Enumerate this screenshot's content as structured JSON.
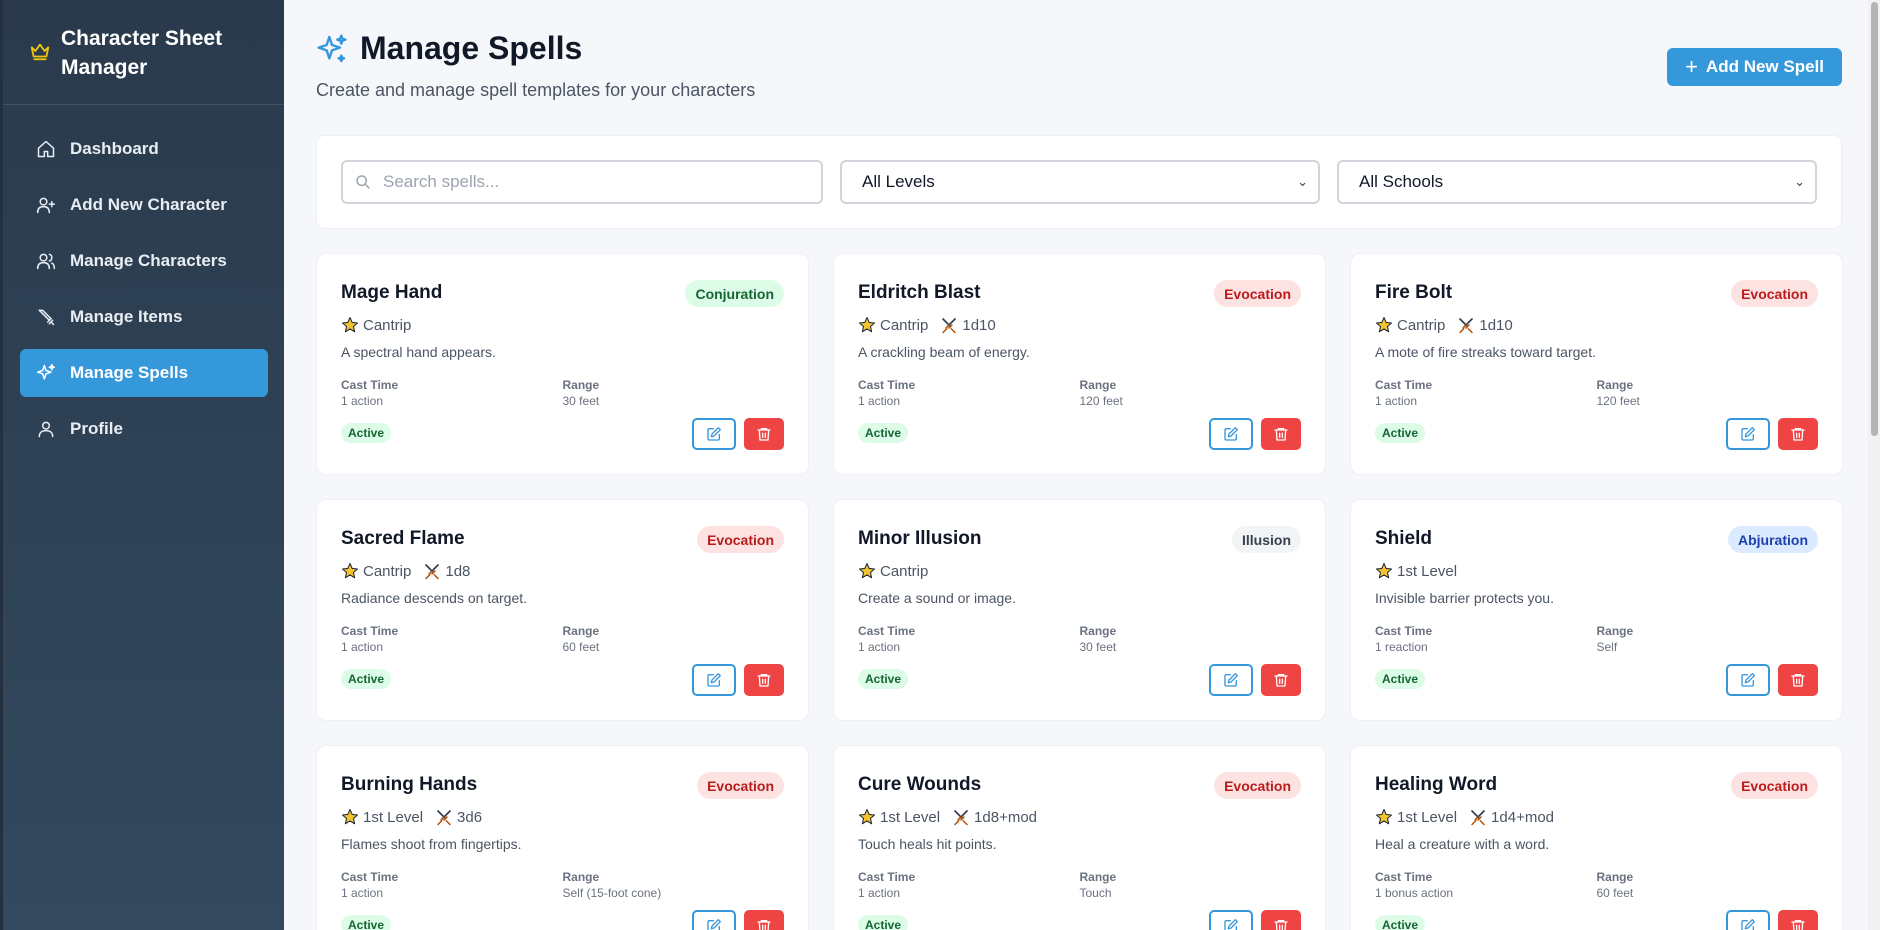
{
  "app": {
    "title": "Character Sheet Manager"
  },
  "sidebar": {
    "items": [
      {
        "label": "Dashboard",
        "icon": "home-icon",
        "active": false
      },
      {
        "label": "Add New Character",
        "icon": "user-plus-icon",
        "active": false
      },
      {
        "label": "Manage Characters",
        "icon": "users-icon",
        "active": false
      },
      {
        "label": "Manage Items",
        "icon": "sword-icon",
        "active": false
      },
      {
        "label": "Manage Spells",
        "icon": "sparkles-icon",
        "active": true
      },
      {
        "label": "Profile",
        "icon": "user-icon",
        "active": false
      }
    ]
  },
  "header": {
    "title": "Manage Spells",
    "subtitle": "Create and manage spell templates for your characters",
    "add_button": "Add New Spell"
  },
  "filters": {
    "search_placeholder": "Search spells...",
    "level_selected": "All Levels",
    "school_selected": "All Schools"
  },
  "labels": {
    "cast_time": "Cast Time",
    "range": "Range"
  },
  "colors": {
    "accent": "#3498db",
    "danger": "#ef4444",
    "sidebar": "#2c3e50"
  },
  "spells": [
    {
      "name": "Mage Hand",
      "school": "Conjuration",
      "level": "Cantrip",
      "damage": "",
      "description": "A spectral hand appears.",
      "cast_time": "1 action",
      "range": "30 feet",
      "status": "Active"
    },
    {
      "name": "Eldritch Blast",
      "school": "Evocation",
      "level": "Cantrip",
      "damage": "1d10",
      "description": "A crackling beam of energy.",
      "cast_time": "1 action",
      "range": "120 feet",
      "status": "Active"
    },
    {
      "name": "Fire Bolt",
      "school": "Evocation",
      "level": "Cantrip",
      "damage": "1d10",
      "description": "A mote of fire streaks toward target.",
      "cast_time": "1 action",
      "range": "120 feet",
      "status": "Active"
    },
    {
      "name": "Sacred Flame",
      "school": "Evocation",
      "level": "Cantrip",
      "damage": "1d8",
      "description": "Radiance descends on target.",
      "cast_time": "1 action",
      "range": "60 feet",
      "status": "Active"
    },
    {
      "name": "Minor Illusion",
      "school": "Illusion",
      "level": "Cantrip",
      "damage": "",
      "description": "Create a sound or image.",
      "cast_time": "1 action",
      "range": "30 feet",
      "status": "Active"
    },
    {
      "name": "Shield",
      "school": "Abjuration",
      "level": "1st Level",
      "damage": "",
      "description": "Invisible barrier protects you.",
      "cast_time": "1 reaction",
      "range": "Self",
      "status": "Active"
    },
    {
      "name": "Burning Hands",
      "school": "Evocation",
      "level": "1st Level",
      "damage": "3d6",
      "description": "Flames shoot from fingertips.",
      "cast_time": "1 action",
      "range": "Self (15-foot cone)",
      "status": "Active"
    },
    {
      "name": "Cure Wounds",
      "school": "Evocation",
      "level": "1st Level",
      "damage": "1d8+mod",
      "description": "Touch heals hit points.",
      "cast_time": "1 action",
      "range": "Touch",
      "status": "Active"
    },
    {
      "name": "Healing Word",
      "school": "Evocation",
      "level": "1st Level",
      "damage": "1d4+mod",
      "description": "Heal a creature with a word.",
      "cast_time": "1 bonus action",
      "range": "60 feet",
      "status": "Active"
    }
  ]
}
